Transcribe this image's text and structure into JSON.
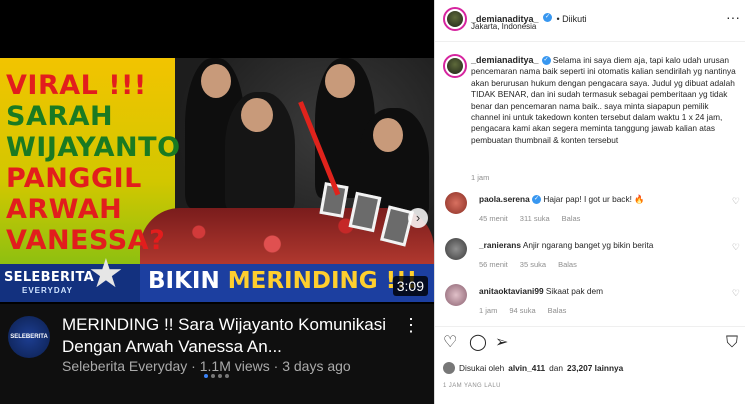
{
  "video": {
    "thumbnail_lines": [
      "VIRAL !!!",
      "SARAH",
      "WIJAYANTO",
      "PANGGIL",
      "ARWAH",
      "VANESSA?"
    ],
    "banner_brand": "SELEBERITA",
    "banner_brand_sub": "EVERYDAY",
    "banner_word1": "BIKIN",
    "banner_word2": "MERINDING !!!",
    "duration": "3:09",
    "title": "MERINDING !! Sara Wijayanto Komunikasi Dengan Arwah Vanessa An...",
    "meta": "Seleberita Everyday · 1.1M views · 3 days ago",
    "channel_avatar_text": "SELEBERITA"
  },
  "post": {
    "username": "_demianaditya_",
    "follow_status": "Diikuti",
    "location": "Jakarta, Indonesia",
    "caption": "Selama ini saya diem aja, tapi kalo udah urusan pencemaran nama baik seperti ini otomatis kalian sendirilah yg nantinya akan berurusan hukum dengan pengacara saya. Judul yg dibuat adalah TIDAK BENAR, dan ini sudah termasuk sebagai pemberitaan yg tidak benar dan pencemaran nama baik.. saya minta siapapun pemilik channel ini untuk takedown konten tersebut dalam waktu 1 x 24 jam, pengacara kami akan segera meminta tanggung jawab kalian atas pembuatan thumbnail & konten tersebut",
    "caption_time": "1 jam",
    "comments": [
      {
        "user": "paola.serena",
        "text": "Hajar pap! I got ur back! 🔥",
        "time": "45 menit",
        "likes": "311 suka",
        "reply": "Balas"
      },
      {
        "user": "_ranierans",
        "text": "Anjir ngarang banget yg bikin berita",
        "time": "56 menit",
        "likes": "35 suka",
        "reply": "Balas"
      },
      {
        "user": "anitaoktaviani99",
        "text": "Sikaat pak dem",
        "time": "1 jam",
        "likes": "94 suka",
        "reply": "Balas"
      }
    ],
    "liked_prefix": "Disukai oleh",
    "liked_user": "alvin_411",
    "liked_mid": "dan",
    "liked_count": "23,207 lainnya",
    "time_ago": "1 JAM YANG LALU"
  },
  "icons": [
    "heart-icon",
    "comment-icon",
    "share-icon",
    "bookmark-icon",
    "more-icon",
    "verified-icon",
    "chevron-right-icon"
  ]
}
